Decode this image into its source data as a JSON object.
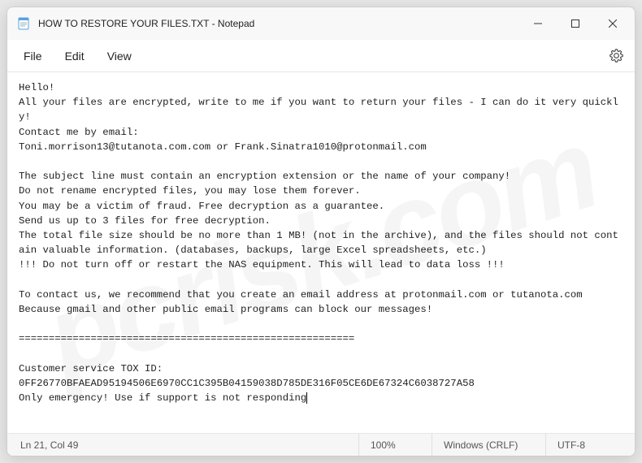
{
  "window": {
    "title": "HOW TO RESTORE YOUR FILES.TXT - Notepad",
    "app_icon": "notepad-icon"
  },
  "window_controls": {
    "minimize": "minimize",
    "maximize": "maximize",
    "close": "close"
  },
  "menu": {
    "file": "File",
    "edit": "Edit",
    "view": "View",
    "settings_icon": "gear-icon"
  },
  "document": {
    "text": "Hello!\nAll your files are encrypted, write to me if you want to return your files - I can do it very quickly!\nContact me by email:\nToni.morrison13@tutanota.com.com or Frank.Sinatra1010@protonmail.com\n\nThe subject line must contain an encryption extension or the name of your company!\nDo not rename encrypted files, you may lose them forever.\nYou may be a victim of fraud. Free decryption as a guarantee.\nSend us up to 3 files for free decryption.\nThe total file size should be no more than 1 MB! (not in the archive), and the files should not contain valuable information. (databases, backups, large Excel spreadsheets, etc.)\n!!! Do not turn off or restart the NAS equipment. This will lead to data loss !!!\n\nTo contact us, we recommend that you create an email address at protonmail.com or tutanota.com\nBecause gmail and other public email programs can block our messages!\n\n========================================================\n\nCustomer service TOX ID:\n0FF26770BFAEAD95194506E6970CC1C395B04159038D785DE316F05CE6DE67324C6038727A58\nOnly emergency! Use if support is not responding"
  },
  "statusbar": {
    "position": "Ln 21, Col 49",
    "zoom": "100%",
    "line_ending": "Windows (CRLF)",
    "encoding": "UTF-8"
  },
  "watermark": "pcrisk.com"
}
